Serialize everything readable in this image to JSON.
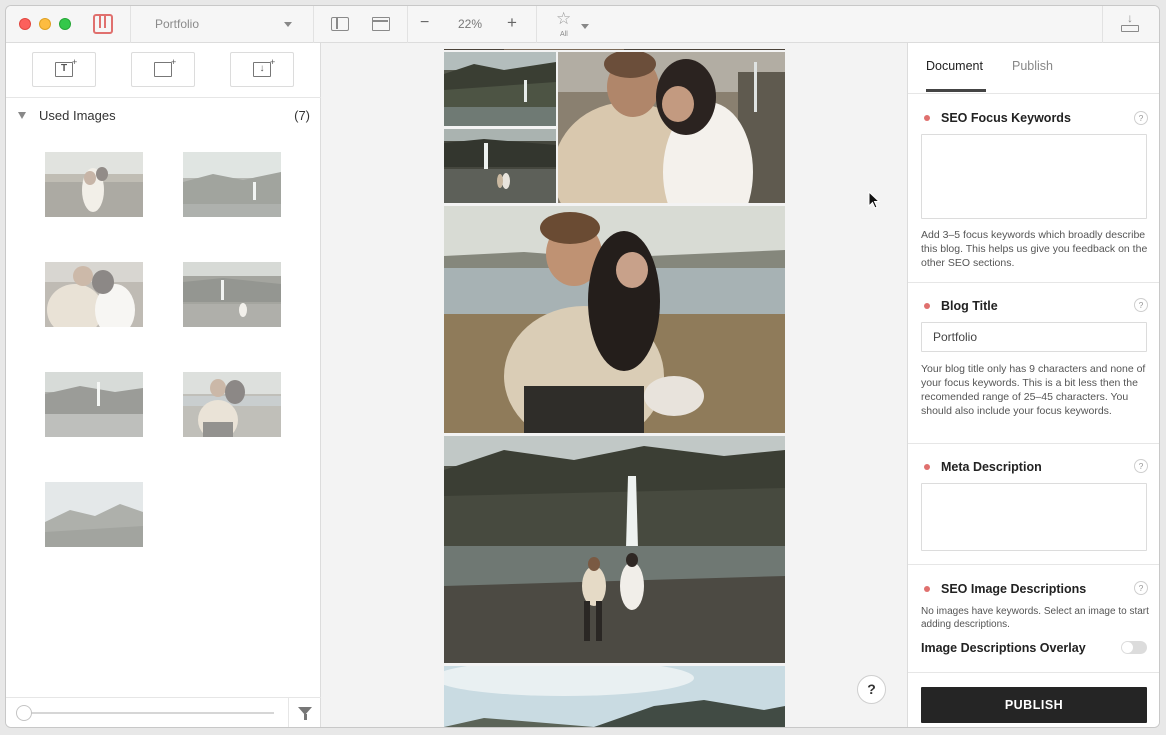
{
  "toolbar": {
    "document_name": "Portfolio",
    "zoom_level": "22%",
    "zoom_minus": "−",
    "zoom_plus": "+",
    "filter_label": "All",
    "icons": [
      "app-logo-icon",
      "panel-toggle-icon",
      "folder-icon",
      "star-filter-icon",
      "download-icon"
    ]
  },
  "sidebar": {
    "tools": [
      {
        "name": "add-text-block",
        "glyph": "T"
      },
      {
        "name": "add-image-block",
        "glyph": ""
      },
      {
        "name": "add-import-block",
        "glyph": "↓"
      }
    ],
    "used_images_title": "Used Images",
    "used_images_count": "(7)"
  },
  "canvas": {
    "help_label": "?"
  },
  "panel": {
    "tabs": [
      {
        "label": "Document",
        "active": true
      },
      {
        "label": "Publish",
        "active": false
      }
    ],
    "seo_keywords": {
      "title": "SEO Focus Keywords",
      "value": "",
      "help": "Add 3–5 focus keywords which broadly describe this blog. This helps us give you feedback on the other SEO sections."
    },
    "blog_title": {
      "title": "Blog Title",
      "value": "Portfolio",
      "help": "Your blog title only has 9 characters and none of your focus keywords. This is a bit less then the recomended range of 25–45 characters. You should also include your focus keywords."
    },
    "meta_description": {
      "title": "Meta Description",
      "value": ""
    },
    "seo_images": {
      "title": "SEO Image Descriptions",
      "help": "No images have keywords. Select an image to start adding descriptions."
    },
    "overlay_label": "Image Descriptions Overlay",
    "overlay_on": false,
    "question": "?",
    "publish_label": "PUBLISH"
  },
  "colors": {
    "accent_dot": "#e0706e",
    "publish_bg": "#252525"
  }
}
